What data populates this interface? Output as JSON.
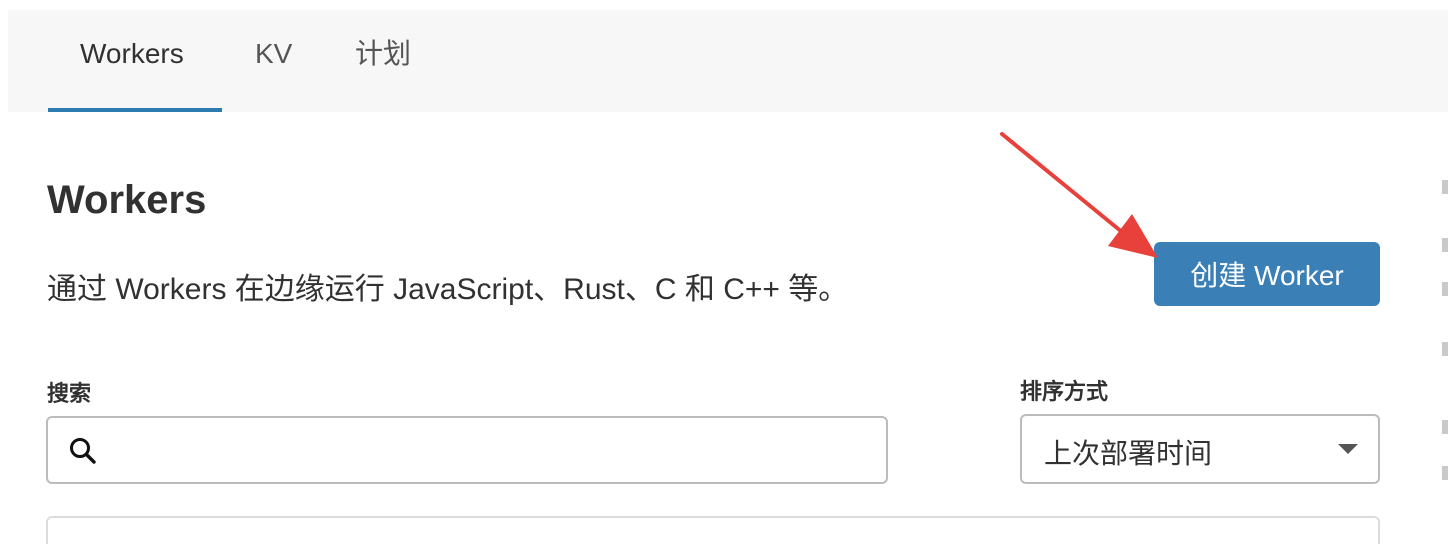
{
  "tabs": [
    {
      "label": "Workers",
      "active": true
    },
    {
      "label": "KV",
      "active": false
    },
    {
      "label": "计划",
      "active": false
    }
  ],
  "header": {
    "title": "Workers",
    "description": "通过 Workers 在边缘运行 JavaScript、Rust、C 和 C++ 等。",
    "create_button_label": "创建 Worker"
  },
  "search": {
    "label": "搜索",
    "value": "",
    "placeholder": "",
    "icon": "search-icon"
  },
  "sort": {
    "label": "排序方式",
    "selected": "上次部署时间",
    "icon": "caret-down-icon"
  },
  "colors": {
    "accent": "#3a7fb5",
    "tab_underline": "#2c7cb0",
    "annotation_arrow": "#e8403a"
  }
}
